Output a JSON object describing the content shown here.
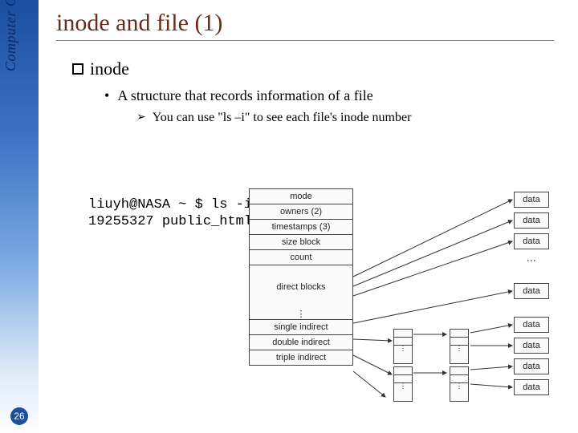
{
  "sidebar": {
    "org_text": "Computer Center, CS, NCTU"
  },
  "slide_number": "26",
  "title": "inode and file (1)",
  "bullets": {
    "heading": "inode",
    "sub": "A structure that records information of a file",
    "subsub": "You can use \"ls –i\" to see each file's inode number"
  },
  "terminal": {
    "line1": "liuyh@NASA ~ $ ls -i",
    "line2": "19255327 public_html"
  },
  "diagram": {
    "rows": {
      "mode": "mode",
      "owners": "owners (2)",
      "timestamps": "timestamps (3)",
      "size_block": "size block",
      "count": "count",
      "direct": "direct blocks",
      "single": "single indirect",
      "double": "double indirect",
      "triple": "triple indirect"
    },
    "data_label": "data"
  }
}
